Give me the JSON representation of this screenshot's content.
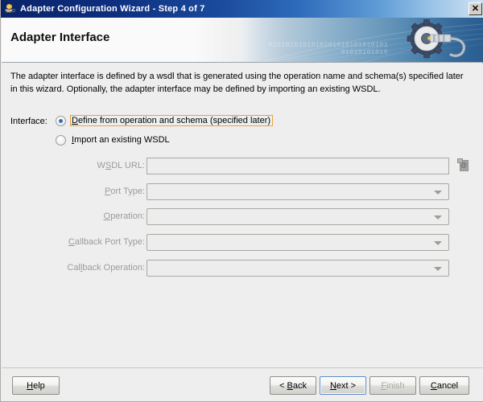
{
  "window": {
    "title": "Adapter Configuration Wizard - Step 4 of 7",
    "icon": "java-coffee-cup-icon",
    "close_label": "✕"
  },
  "banner": {
    "title": "Adapter Interface",
    "graphic": "gear-wrench-icon",
    "binary_line1": "0101010101010101010101010101",
    "binary_line2": "01010101010"
  },
  "description": "The adapter interface is defined by a wsdl that is generated using the operation name and schema(s) specified later in this wizard.  Optionally, the adapter interface may be defined by importing an existing WSDL.",
  "interface": {
    "label": "Interface:",
    "options": [
      {
        "pre": "",
        "mnemonic": "D",
        "post": "efine from operation and schema (specified later)",
        "selected": true,
        "focused": true
      },
      {
        "pre": "",
        "mnemonic": "I",
        "post": "mport an existing WSDL",
        "selected": false,
        "focused": false
      }
    ]
  },
  "fields": [
    {
      "pre": "W",
      "mnemonic": "S",
      "post": "DL URL:",
      "type": "text",
      "value": "",
      "placeholder": "",
      "disabled": true,
      "has_browse": true
    },
    {
      "pre": "",
      "mnemonic": "P",
      "post": "ort Type:",
      "type": "combo",
      "value": "",
      "placeholder": "",
      "disabled": true,
      "has_browse": false
    },
    {
      "pre": "",
      "mnemonic": "O",
      "post": "peration:",
      "type": "combo",
      "value": "",
      "placeholder": "",
      "disabled": true,
      "has_browse": false
    },
    {
      "pre": "",
      "mnemonic": "C",
      "post": "allback Port Type:",
      "type": "combo",
      "value": "",
      "placeholder": "",
      "disabled": true,
      "has_browse": false
    },
    {
      "pre": "Cal",
      "mnemonic": "l",
      "post": "back Operation:",
      "type": "combo",
      "value": "",
      "placeholder": "",
      "disabled": true,
      "has_browse": false
    }
  ],
  "buttons": {
    "help": {
      "pre": "",
      "mnemonic": "H",
      "post": "elp",
      "disabled": false,
      "default": false
    },
    "back": {
      "pre": "< ",
      "mnemonic": "B",
      "post": "ack",
      "disabled": false,
      "default": false
    },
    "next": {
      "pre": "",
      "mnemonic": "N",
      "post": "ext >",
      "disabled": false,
      "default": true
    },
    "finish": {
      "pre": "",
      "mnemonic": "F",
      "post": "inish",
      "disabled": true,
      "default": false
    },
    "cancel": {
      "pre": "",
      "mnemonic": "C",
      "post": "ancel",
      "disabled": false,
      "default": false
    }
  },
  "colors": {
    "accent_focus": "#e8a33d",
    "default_button_border": "#5b89c4",
    "titlebar_start": "#0a246a",
    "panel_bg": "#eeeeee",
    "disabled_text": "#9b9b97"
  }
}
